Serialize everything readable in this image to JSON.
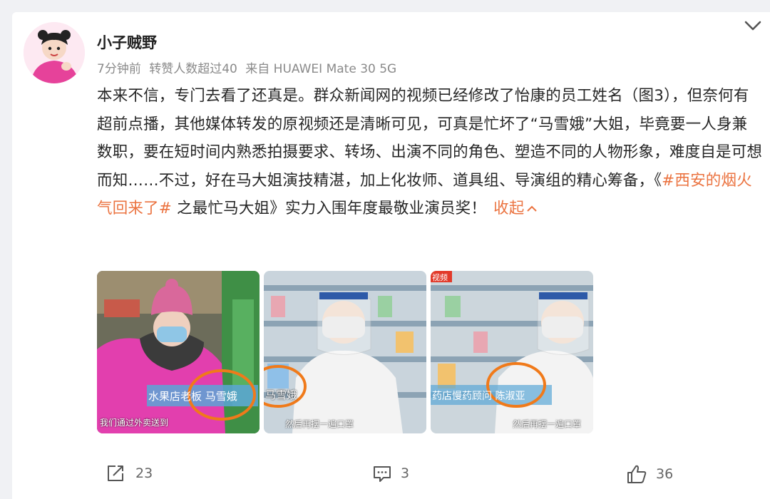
{
  "post": {
    "author": "小子贼野",
    "time": "7分钟前",
    "repost_note": "转赞人数超过40",
    "source": "来自 HUAWEI Mate 30 5G",
    "text": {
      "part1": "本来不信，专门去看了还真是。群众新闻网的视频已经修改了怡康的员工姓名（图3），但奈何有超前点播，其他媒体转发的原视频还是清晰可见，可真是忙坏了“马雪娥”大姐，毕竟要一人身兼数职，要在短时间内熟悉拍摄要求、转场、出演不同的角色、塑造不同的人物形象，难度自是可想而知……不过，好在马大姐演技精湛，加上化妆师、道具组、导演组的精心筹备，《",
      "hashtag": "#西安的烟火气回来了#",
      "part2": " 之最忙马大姐》实力入围年度最敬业演员奖！",
      "collapse_label": "收起"
    },
    "photos": [
      {
        "caption": "水果店老板 马雪娥",
        "subtitle": "我们通过外卖送到"
      },
      {
        "caption": "马雪娥",
        "subtitle": "然后再摆一遍口罩"
      },
      {
        "caption": "药店慢药顾问 陈淑亚",
        "subtitle": "然后再摆一遍口罩",
        "corner_tag": "视频"
      }
    ],
    "actions": {
      "repost_count": "23",
      "comment_count": "3",
      "like_count": "36"
    }
  },
  "colors": {
    "accent": "#eb7340",
    "circle_annotation": "#f07a1a",
    "text_main": "#262626",
    "text_meta": "#8a8a8a"
  },
  "icons": [
    "chevron-down-icon",
    "repost-icon",
    "comment-icon",
    "like-icon"
  ]
}
